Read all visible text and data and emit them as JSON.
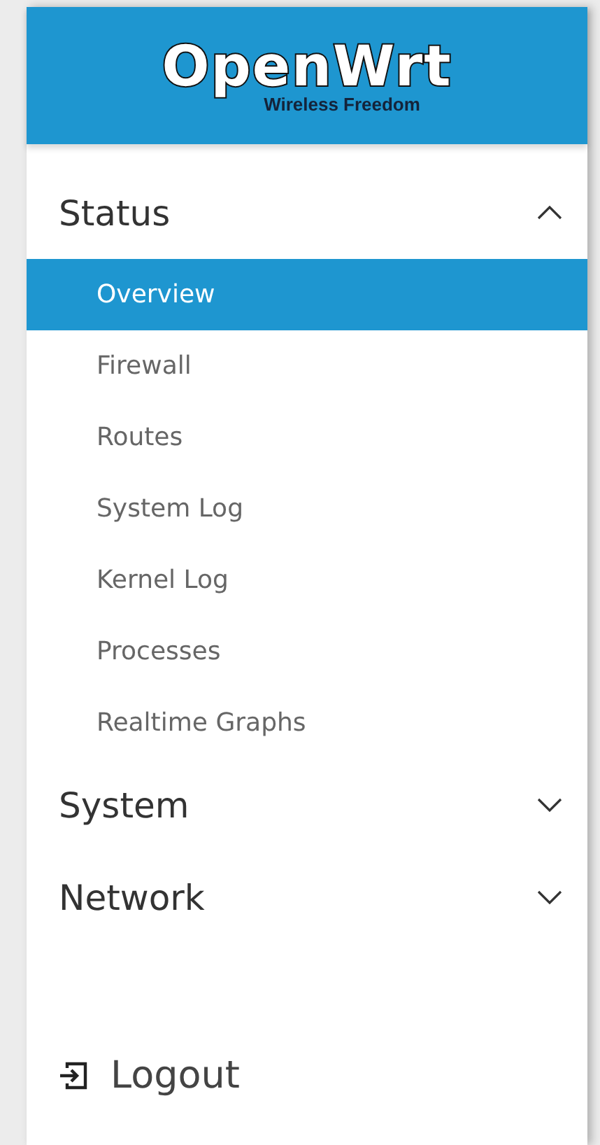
{
  "logo": {
    "title": "OpenWrt",
    "subtitle": "Wireless Freedom"
  },
  "menu": [
    {
      "label": "Status",
      "expanded": true,
      "children": [
        {
          "label": "Overview",
          "selected": true
        },
        {
          "label": "Firewall",
          "selected": false
        },
        {
          "label": "Routes",
          "selected": false
        },
        {
          "label": "System Log",
          "selected": false
        },
        {
          "label": "Kernel Log",
          "selected": false
        },
        {
          "label": "Processes",
          "selected": false
        },
        {
          "label": "Realtime Graphs",
          "selected": false
        }
      ]
    },
    {
      "label": "System",
      "expanded": false
    },
    {
      "label": "Network",
      "expanded": false
    }
  ],
  "logout": {
    "label": "Logout"
  }
}
